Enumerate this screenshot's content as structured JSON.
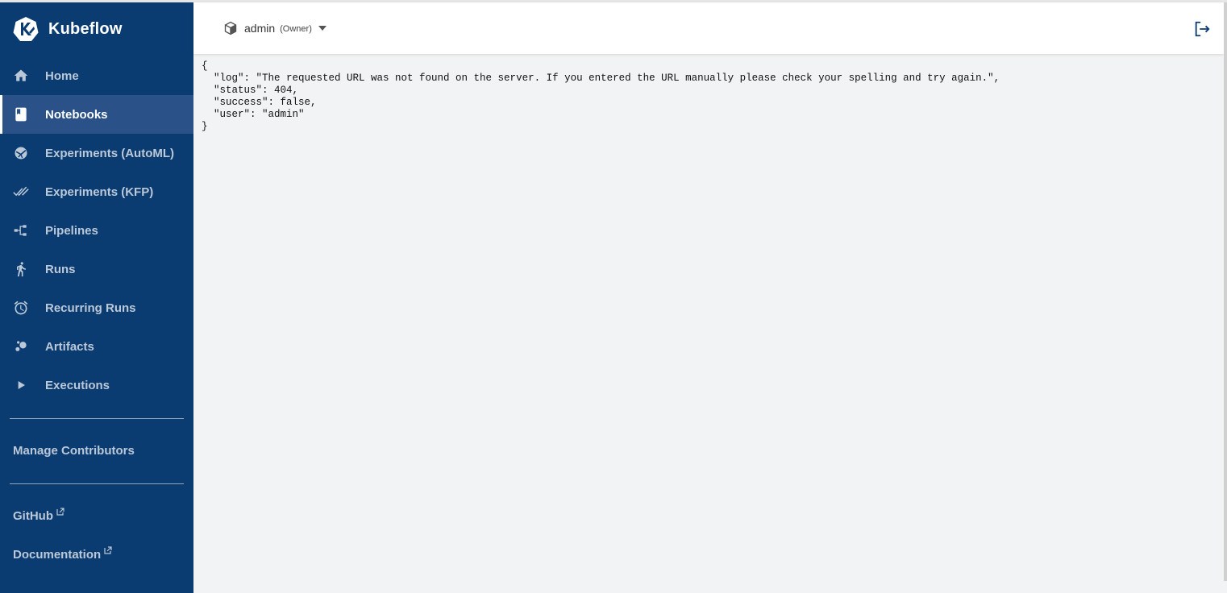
{
  "app": {
    "brand_name": "Kubeflow"
  },
  "header": {
    "namespace": "admin",
    "role": "(Owner)"
  },
  "sidebar": {
    "items": [
      {
        "label": "Home",
        "icon": "home-icon",
        "active": false
      },
      {
        "label": "Notebooks",
        "icon": "book-icon",
        "active": true
      },
      {
        "label": "Experiments (AutoML)",
        "icon": "automl-icon",
        "active": false
      },
      {
        "label": "Experiments (KFP)",
        "icon": "double-check-icon",
        "active": false
      },
      {
        "label": "Pipelines",
        "icon": "pipeline-icon",
        "active": false
      },
      {
        "label": "Runs",
        "icon": "running-person-icon",
        "active": false
      },
      {
        "label": "Recurring Runs",
        "icon": "alarm-clock-icon",
        "active": false
      },
      {
        "label": "Artifacts",
        "icon": "bubbles-icon",
        "active": false
      },
      {
        "label": "Executions",
        "icon": "play-icon",
        "active": false
      }
    ],
    "manage_contributors": "Manage Contributors",
    "links": [
      {
        "label": "GitHub",
        "icon": "external-link-icon"
      },
      {
        "label": "Documentation",
        "icon": "external-link-icon"
      }
    ]
  },
  "content": {
    "json_text": "{\n  \"log\": \"The requested URL was not found on the server. If you entered the URL manually please check your spelling and try again.\",\n  \"status\": 404,\n  \"success\": false,\n  \"user\": \"admin\"\n}"
  },
  "colors": {
    "sidebar_bg": "#0a3b71",
    "sidebar_active": "#2a5288",
    "content_bg": "#f1f3f4",
    "header_bg": "#ffffff"
  }
}
